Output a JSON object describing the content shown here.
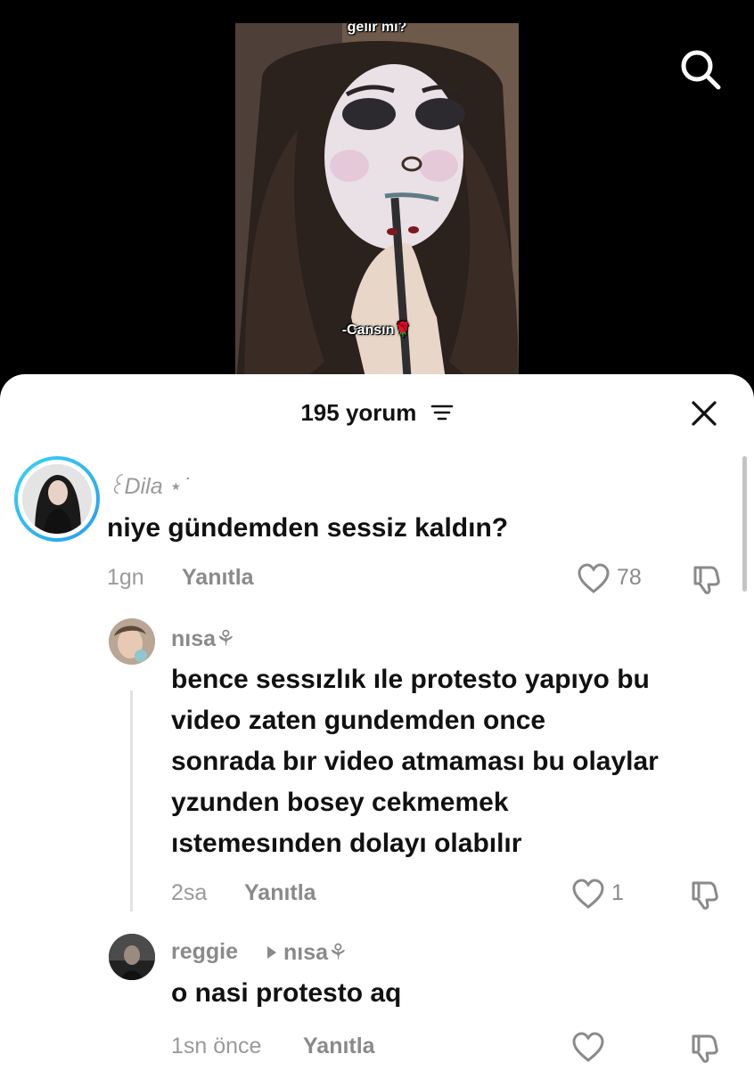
{
  "video": {
    "caption_top": "gelir mi?",
    "caption_bottom": "-Cansın🌹"
  },
  "search": {
    "icon": "search-icon"
  },
  "sheet": {
    "title": "195 yorum",
    "sort_icon": "sort-icon",
    "close_icon": "close-icon"
  },
  "comments": [
    {
      "author": "꒰Dila ⋆˙",
      "text": "niye gündemden sessiz kaldın?",
      "time": "1gn",
      "reply_label": "Yanıtla",
      "likes": "78"
    },
    {
      "author": "nısa⚘",
      "text_lines": [
        "bence sessızlık ıle protesto yapıyo bu",
        "video zaten gundemden once",
        "sonrada bır video atmaması bu olaylar",
        "yzunden bosey cekmemek",
        "ıstemesınden dolayı olabılır"
      ],
      "time": "2sa",
      "reply_label": "Yanıtla",
      "likes": "1"
    },
    {
      "author": "reggie",
      "reply_to": "nısa⚘",
      "text": "o nasi protesto aq",
      "time": "1sn önce",
      "reply_label": "Yanıtla",
      "likes": ""
    }
  ],
  "colors": {
    "story_ring_start": "#38d3f0",
    "story_ring_end": "#2a9df0",
    "muted_text": "#8a8a8a"
  }
}
